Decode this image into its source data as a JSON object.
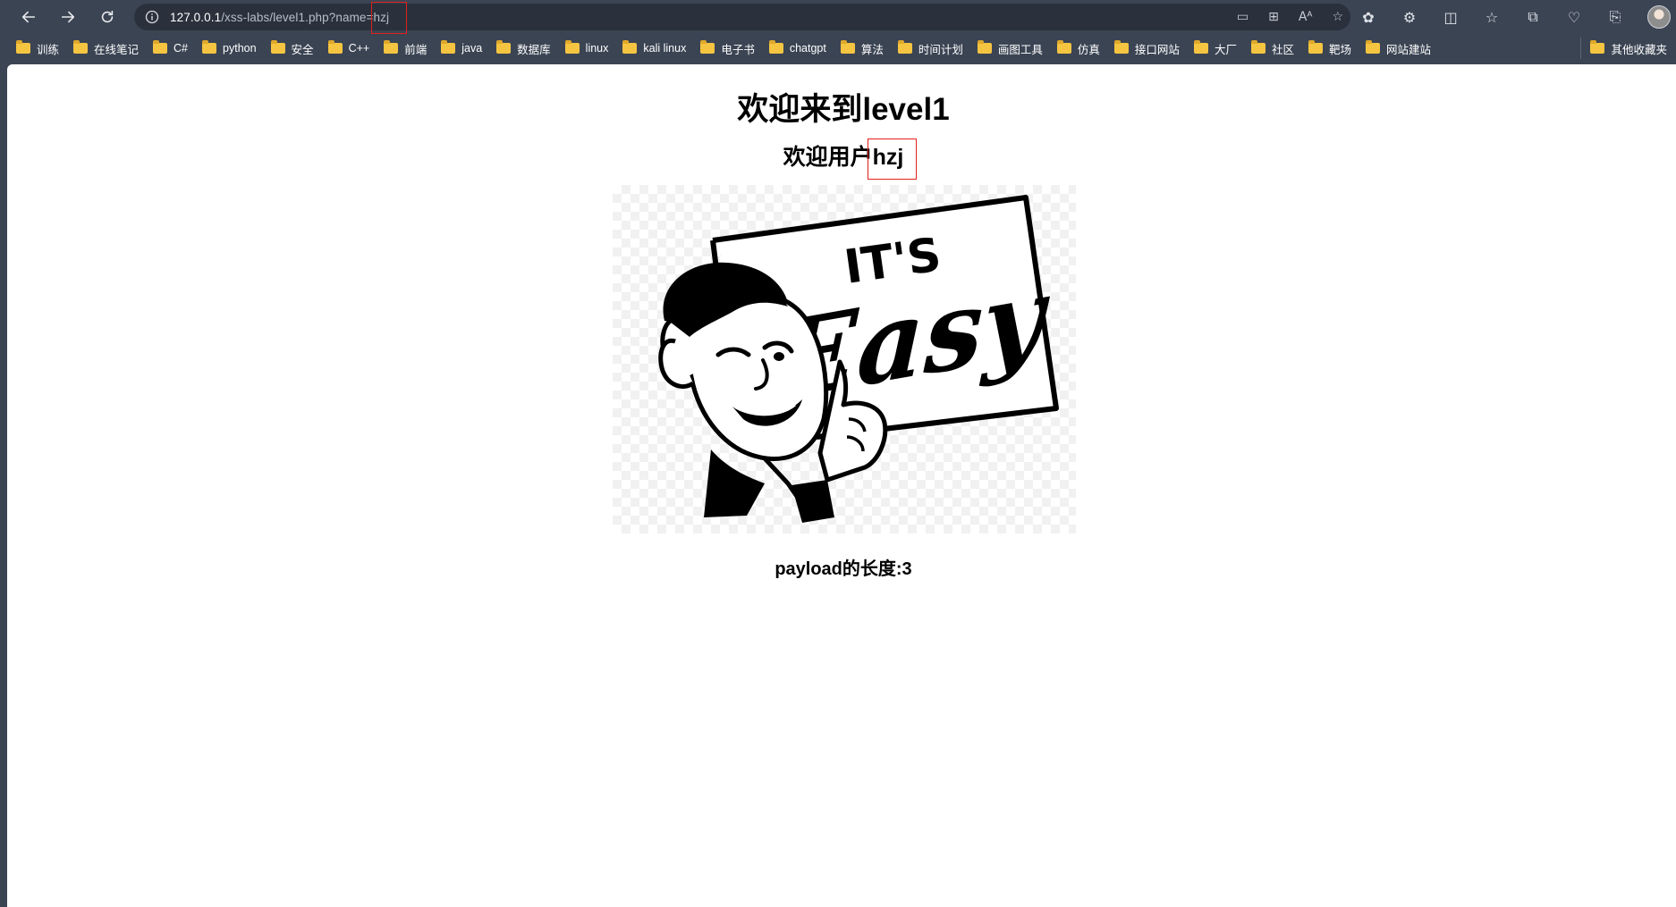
{
  "browser": {
    "url_host": "127.0.0.1",
    "url_path": "/xss-labs/level1.php?name=hzj",
    "bookmarks": [
      "训练",
      "在线笔记",
      "C#",
      "python",
      "安全",
      "C++",
      "前端",
      "java",
      "数据库",
      "linux",
      "kali linux",
      "电子书",
      "chatgpt",
      "算法",
      "时间计划",
      "画图工具",
      "仿真",
      "接口网站",
      "大厂",
      "社区",
      "靶场",
      "网站建站"
    ],
    "other_bookmarks": "其他收藏夹"
  },
  "page": {
    "title": "欢迎来到level1",
    "welcome_prefix": "欢迎用户",
    "username": "hzj",
    "image": {
      "sign_text_top": "IT'S",
      "sign_text_main": "Easy"
    },
    "payload_label": "payload的长度:3"
  },
  "colors": {
    "highlight": "#e0201c",
    "chrome_bg": "#3b4453",
    "folder": "#f5c542"
  }
}
